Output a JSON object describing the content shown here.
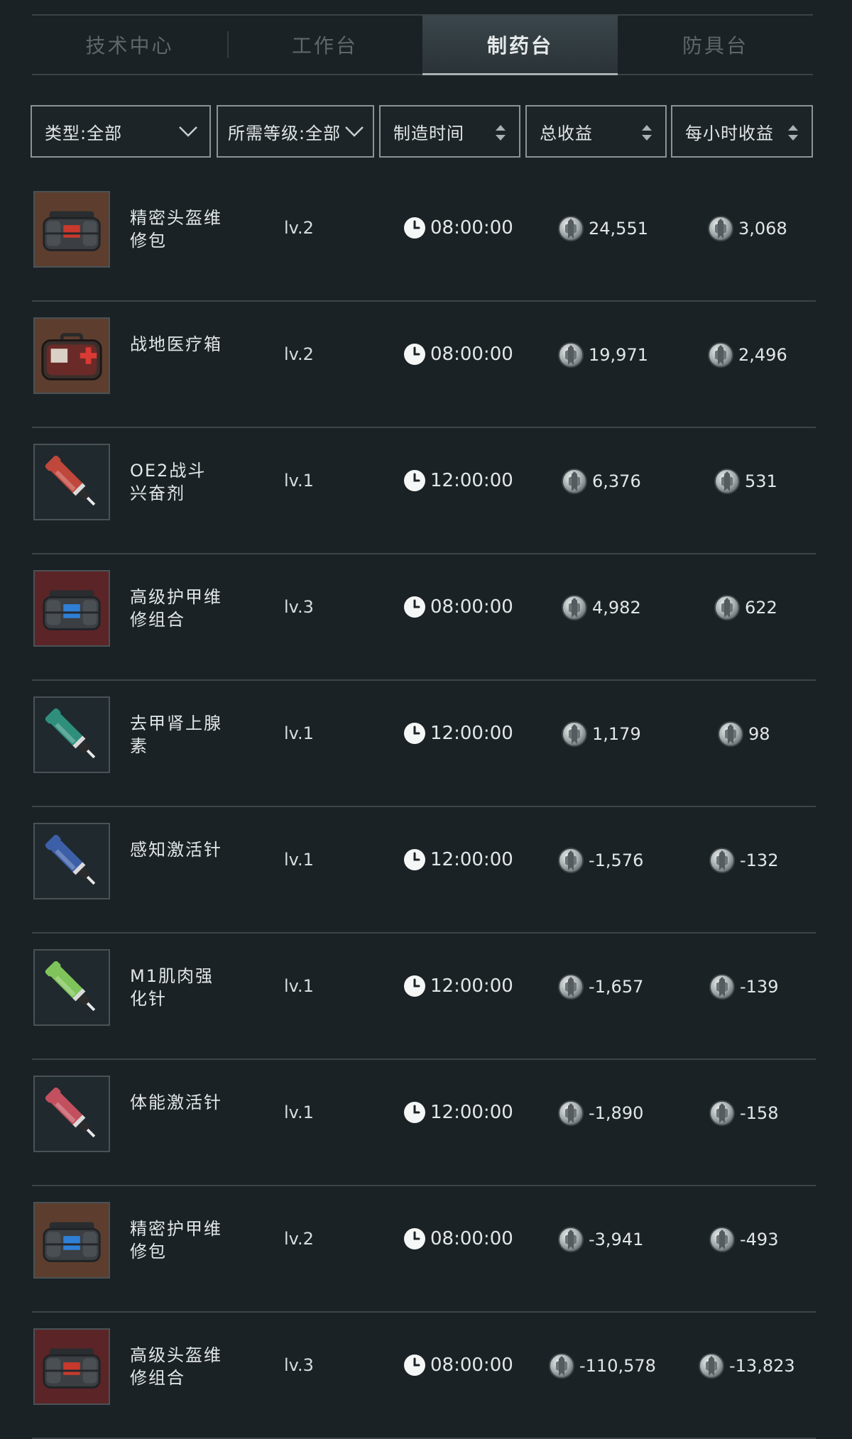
{
  "tabs": [
    "技术中心",
    "工作台",
    "制药台",
    "防具台"
  ],
  "active_tab": 2,
  "filters": {
    "type": "类型:全部",
    "level": "所需等级:全部",
    "time": "制造时间",
    "total": "总收益",
    "per_hour": "每小时收益"
  },
  "items": [
    {
      "name": "精密头盔维修包",
      "level": "lv.2",
      "time": "08:00:00",
      "total": "24,551",
      "per_hour": "3,068"
    },
    {
      "name": "战地医疗箱",
      "level": "lv.2",
      "time": "08:00:00",
      "total": "19,971",
      "per_hour": "2,496"
    },
    {
      "name": "OE2战斗兴奋剂",
      "level": "lv.1",
      "time": "12:00:00",
      "total": "6,376",
      "per_hour": "531"
    },
    {
      "name": "高级护甲维修组合",
      "level": "lv.3",
      "time": "08:00:00",
      "total": "4,982",
      "per_hour": "622"
    },
    {
      "name": "去甲肾上腺素",
      "level": "lv.1",
      "time": "12:00:00",
      "total": "1,179",
      "per_hour": "98"
    },
    {
      "name": "感知激活针",
      "level": "lv.1",
      "time": "12:00:00",
      "total": "-1,576",
      "per_hour": "-132"
    },
    {
      "name": "M1肌肉强化针",
      "level": "lv.1",
      "time": "12:00:00",
      "total": "-1,657",
      "per_hour": "-139"
    },
    {
      "name": "体能激活针",
      "level": "lv.1",
      "time": "12:00:00",
      "total": "-1,890",
      "per_hour": "-158"
    },
    {
      "name": "精密护甲维修包",
      "level": "lv.2",
      "time": "08:00:00",
      "total": "-3,941",
      "per_hour": "-493"
    },
    {
      "name": "高级头盔维修组合",
      "level": "lv.3",
      "time": "08:00:00",
      "total": "-110,578",
      "per_hour": "-13,823"
    }
  ],
  "thumb_icons": [
    "repair-bag-icon",
    "medical-kit-icon",
    "syringe-orange-icon",
    "armor-repair-kit-icon",
    "syringe-teal-icon",
    "syringe-blue-icon",
    "syringe-green-icon",
    "syringe-red-icon",
    "repair-bag-icon",
    "armor-repair-kit-icon"
  ],
  "colors": {
    "accent": "#a9b2b4",
    "background": "#1b2226",
    "divider": "#3c4549"
  }
}
